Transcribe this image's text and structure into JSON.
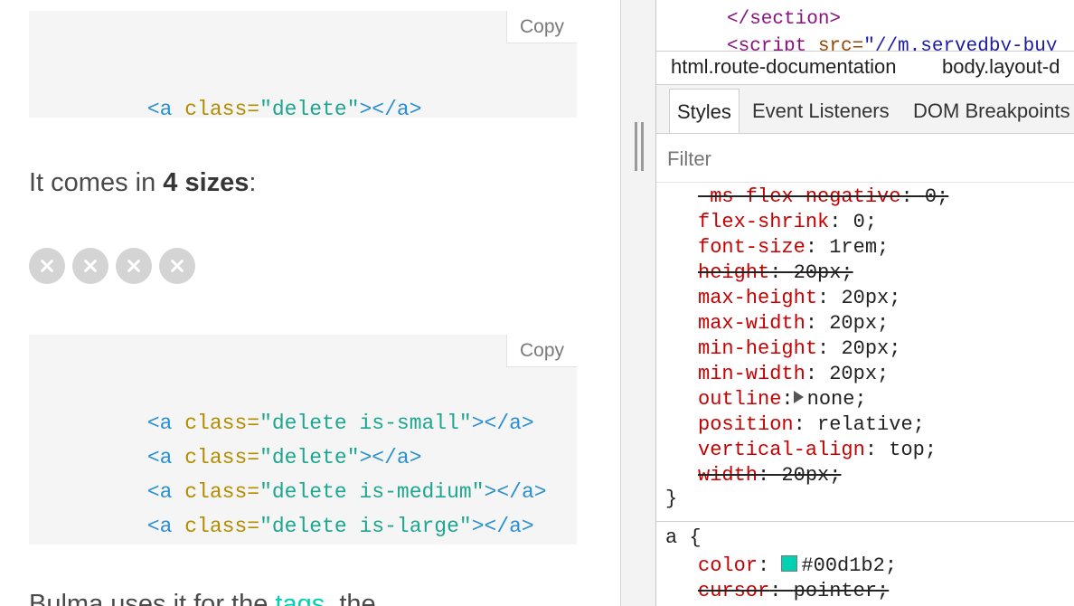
{
  "page": {
    "copy_label": "Copy",
    "block1": {
      "lines": [
        {
          "open": "<a",
          "attr": "class=",
          "value": "\"delete\"",
          "close": "></a>"
        }
      ]
    },
    "para1": {
      "before": "It comes in ",
      "bold": "4 sizes",
      "after": ":"
    },
    "delete_buttons": 4,
    "block2": {
      "lines": [
        {
          "open": "<a",
          "attr": "class=",
          "value": "\"delete is-small\"",
          "close": "></a>"
        },
        {
          "open": "<a",
          "attr": "class=",
          "value": "\"delete\"",
          "close": "></a>"
        },
        {
          "open": "<a",
          "attr": "class=",
          "value": "\"delete is-medium\"",
          "close": "></a>"
        },
        {
          "open": "<a",
          "attr": "class=",
          "value": "\"delete is-large\"",
          "close": "></a>"
        }
      ]
    },
    "para2": {
      "before": "Bulma uses it for the ",
      "link": "tags",
      "after": ", the"
    }
  },
  "devtools": {
    "dom": {
      "line1": "</section>",
      "line2_tag": "<script",
      "line2_attr": " src=",
      "line2_val": "\"//m.servedby-buy"
    },
    "breadcrumbs": [
      "html.route-documentation",
      "body.layout-d"
    ],
    "tabs": [
      "Styles",
      "Event Listeners",
      "DOM Breakpoints"
    ],
    "filter_placeholder": "Filter",
    "rule1": [
      {
        "name": "-ms-flex-negative",
        "value": "0;",
        "overridden": true
      },
      {
        "name": "flex-shrink",
        "value": "0;",
        "overridden": false
      },
      {
        "name": "font-size",
        "value": "1rem;",
        "overridden": false
      },
      {
        "name": "height",
        "value": "20px;",
        "overridden": true
      },
      {
        "name": "max-height",
        "value": "20px;",
        "overridden": false
      },
      {
        "name": "max-width",
        "value": "20px;",
        "overridden": false
      },
      {
        "name": "min-height",
        "value": "20px;",
        "overridden": false
      },
      {
        "name": "min-width",
        "value": "20px;",
        "overridden": false
      },
      {
        "name": "outline",
        "value": "none;",
        "overridden": false,
        "expandable": true
      },
      {
        "name": "position",
        "value": "relative;",
        "overridden": false
      },
      {
        "name": "vertical-align",
        "value": "top;",
        "overridden": false
      },
      {
        "name": "width",
        "value": "20px;",
        "overridden": true
      }
    ],
    "rule1_close": "}",
    "rule2_selector": "a {",
    "rule2": [
      {
        "name": "color",
        "value": "#00d1b2;",
        "overridden": false,
        "swatch": "#00d1b2"
      },
      {
        "name": "cursor",
        "value": "pointer;",
        "overridden": true
      }
    ]
  },
  "colors": {
    "accent": "#00d1b2",
    "delete_bg": "#d4d4d4",
    "prop_name": "#c80000"
  }
}
